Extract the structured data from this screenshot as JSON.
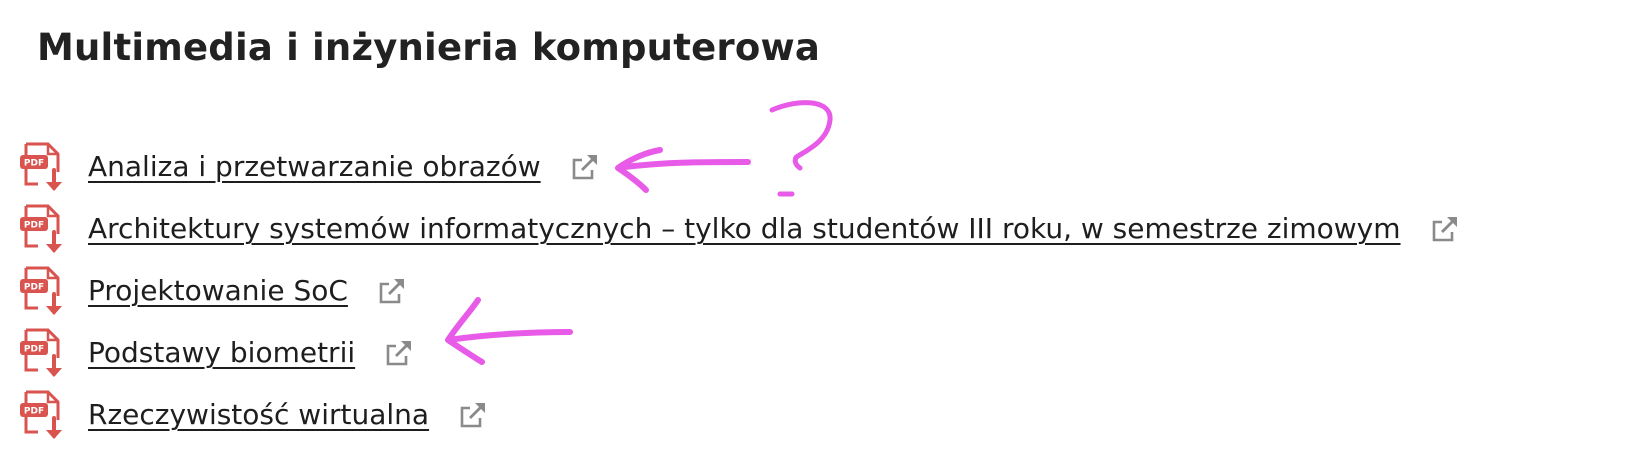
{
  "page": {
    "title": "Multimedia i inżynieria komputerowa"
  },
  "documents": [
    {
      "label": "Analiza i przetwarzanie obrazów",
      "icon": "pdf-download-icon",
      "link_icon": "external-link-icon"
    },
    {
      "label": "Architektury systemów informatycznych – tylko dla studentów III roku, w semestrze zimowym",
      "icon": "pdf-download-icon",
      "link_icon": "external-link-icon"
    },
    {
      "label": "Projektowanie SoC",
      "icon": "pdf-download-icon",
      "link_icon": "external-link-icon"
    },
    {
      "label": "Podstawy biometrii",
      "icon": "pdf-download-icon",
      "link_icon": "external-link-icon"
    },
    {
      "label": "Rzeczywistość wirtualna",
      "icon": "pdf-download-icon",
      "link_icon": "external-link-icon"
    }
  ],
  "icon_labels": {
    "pdf": "PDF"
  },
  "colors": {
    "pdf_red": "#d9534f",
    "link_icon_gray": "#8a8a8a",
    "annotation_magenta": "#e85ae8",
    "text": "#222222"
  }
}
